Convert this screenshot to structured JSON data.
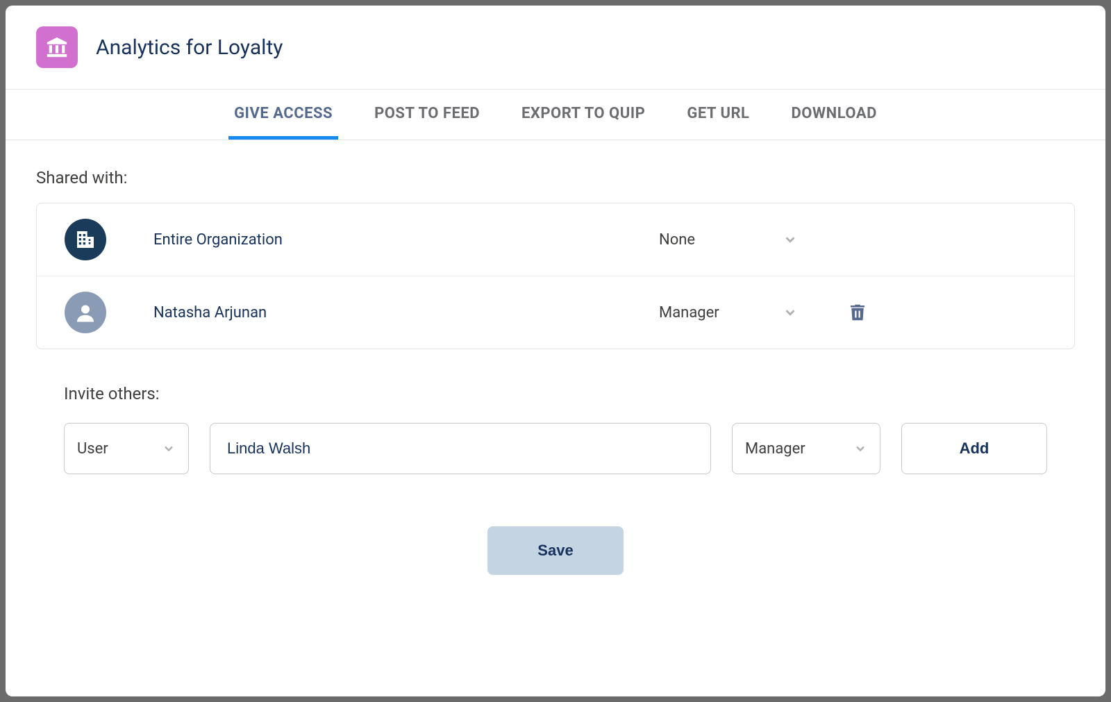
{
  "header": {
    "title": "Analytics for Loyalty"
  },
  "tabs": [
    {
      "label": "GIVE ACCESS",
      "active": true
    },
    {
      "label": "POST TO FEED",
      "active": false
    },
    {
      "label": "EXPORT TO QUIP",
      "active": false
    },
    {
      "label": "GET URL",
      "active": false
    },
    {
      "label": "DOWNLOAD",
      "active": false
    }
  ],
  "shared_with": {
    "label": "Shared with:",
    "rows": [
      {
        "name": "Entire Organization",
        "role": "None",
        "type": "org",
        "deletable": false
      },
      {
        "name": "Natasha Arjunan",
        "role": "Manager",
        "type": "user",
        "deletable": true
      }
    ]
  },
  "invite": {
    "label": "Invite others:",
    "type_selected": "User",
    "name_value": "Linda Walsh",
    "role_selected": "Manager",
    "add_label": "Add"
  },
  "actions": {
    "save_label": "Save"
  }
}
